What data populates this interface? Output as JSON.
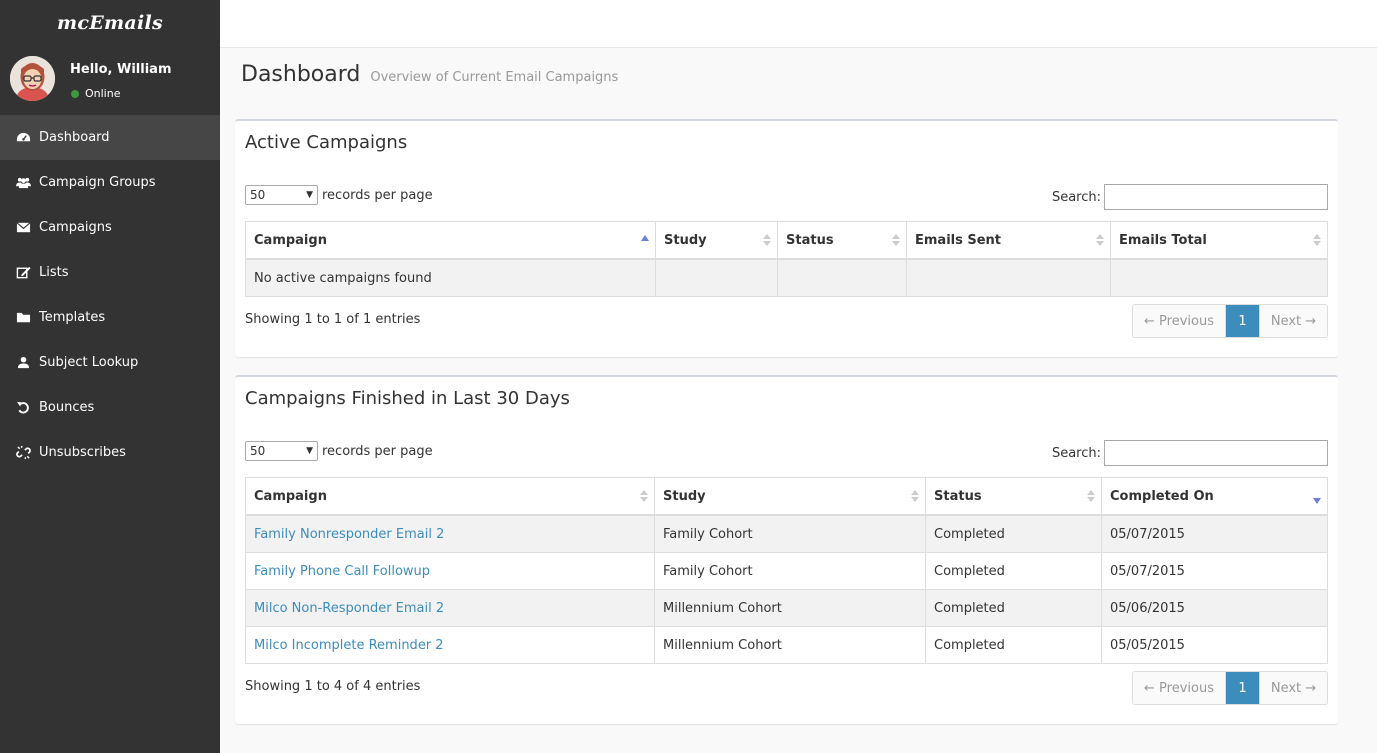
{
  "app": {
    "brand": "mcEmails"
  },
  "user": {
    "greeting": "Hello, William",
    "status": "Online"
  },
  "sidebar": {
    "items": [
      {
        "label": "Dashboard",
        "icon": "dashboard-icon",
        "active": true
      },
      {
        "label": "Campaign Groups",
        "icon": "users-icon"
      },
      {
        "label": "Campaigns",
        "icon": "envelope-icon"
      },
      {
        "label": "Lists",
        "icon": "edit-icon"
      },
      {
        "label": "Templates",
        "icon": "folder-icon"
      },
      {
        "label": "Subject Lookup",
        "icon": "user-icon"
      },
      {
        "label": "Bounces",
        "icon": "undo-icon"
      },
      {
        "label": "Unsubscribes",
        "icon": "unlink-icon"
      }
    ]
  },
  "header": {
    "title": "Dashboard",
    "subtitle": "Overview of Current Email Campaigns"
  },
  "active": {
    "title": "Active Campaigns",
    "per_page_value": "50",
    "per_page_label": "records per page",
    "search_label": "Search:",
    "columns": [
      "Campaign",
      "Study",
      "Status",
      "Emails Sent",
      "Emails Total"
    ],
    "empty_message": "No active campaigns found",
    "info": "Showing 1 to 1 of 1 entries",
    "pager": {
      "prev": "← Previous",
      "page": "1",
      "next": "Next →"
    }
  },
  "finished": {
    "title": "Campaigns Finished in Last 30 Days",
    "per_page_value": "50",
    "per_page_label": "records per page",
    "search_label": "Search:",
    "columns": [
      "Campaign",
      "Study",
      "Status",
      "Completed On"
    ],
    "rows": [
      {
        "campaign": "Family Nonresponder Email 2",
        "study": "Family Cohort",
        "status": "Completed",
        "completed": "05/07/2015"
      },
      {
        "campaign": "Family Phone Call Followup",
        "study": "Family Cohort",
        "status": "Completed",
        "completed": "05/07/2015"
      },
      {
        "campaign": "Milco Non-Responder Email 2",
        "study": "Millennium Cohort",
        "status": "Completed",
        "completed": "05/06/2015"
      },
      {
        "campaign": "Milco Incomplete Reminder 2",
        "study": "Millennium Cohort",
        "status": "Completed",
        "completed": "05/05/2015"
      }
    ],
    "info": "Showing 1 to 4 of 4 entries",
    "pager": {
      "prev": "← Previous",
      "page": "1",
      "next": "Next →"
    }
  },
  "colors": {
    "sidebar": "#333333",
    "sidebar_active": "#464646",
    "link": "#3c8dbc",
    "online": "#3c9a3c"
  }
}
